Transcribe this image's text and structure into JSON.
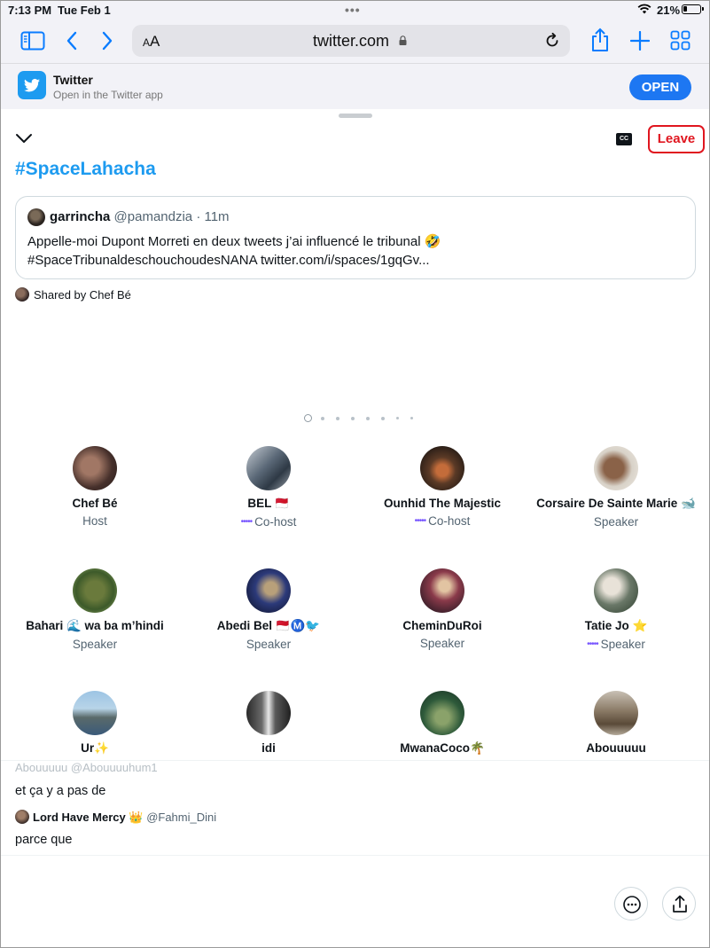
{
  "status_bar": {
    "time": "7:13 PM",
    "date": "Tue Feb 1",
    "battery_pct": "21%"
  },
  "browser": {
    "text_size_label": "AA",
    "url": "twitter.com"
  },
  "app_banner": {
    "name": "Twitter",
    "subtitle": "Open in the Twitter app",
    "open_label": "OPEN"
  },
  "space": {
    "cc_label": "CC",
    "leave_label": "Leave",
    "title": "#SpaceLahacha",
    "pinned_tweet": {
      "author_name": "garrincha",
      "author_handle": "@pamandzia",
      "time": "· 11m",
      "line1": "Appelle-moi Dupont Morreti en deux tweets j’ai influencé le tribunal 🤣",
      "line2": "#SpaceTribunaldeschouchoudesNANA twitter.com/i/spaces/1gqGv..."
    },
    "shared_by": "Shared by Chef Bé",
    "participants": [
      {
        "name": "Chef Bé",
        "role": "Host",
        "speaking": false
      },
      {
        "name": "BEL 🇲🇨",
        "role": "Co-host",
        "speaking": true
      },
      {
        "name": "Ounhid The Majestic",
        "role": "Co-host",
        "speaking": true
      },
      {
        "name": "Corsaire De Sainte Marie 🐋",
        "role": "Speaker",
        "speaking": false
      },
      {
        "name": "Bahari 🌊 wa ba m’hindi",
        "role": "Speaker",
        "speaking": false
      },
      {
        "name": "Abedi Bel 🇲🇨Ⓜ️🐦",
        "role": "Speaker",
        "speaking": false
      },
      {
        "name": "CheminDuRoi",
        "role": "Speaker",
        "speaking": false
      },
      {
        "name": "Tatie Jo ⭐",
        "role": "Speaker",
        "speaking": true
      },
      {
        "name": "Ur✨",
        "role": "",
        "speaking": false
      },
      {
        "name": "idi",
        "role": "",
        "speaking": false
      },
      {
        "name": "MwanaCoco🌴",
        "role": "",
        "speaking": false
      },
      {
        "name": "Abouuuuu",
        "role": "",
        "speaking": false
      }
    ],
    "wave_glyph": "•••••"
  },
  "chat": {
    "faded_author": "Abouuuuu @Abouuuuhum1",
    "message1": "et ça y a pas de",
    "author_name": "Lord Have Mercy 👑",
    "author_handle": "@Fahmi_Dini",
    "message2": "parce que"
  },
  "colors": {
    "twitter_blue": "#1d9bf0",
    "leave_red": "#e0161f",
    "safari_blue": "#0a7cff",
    "cohost_purple": "#7856ff"
  }
}
